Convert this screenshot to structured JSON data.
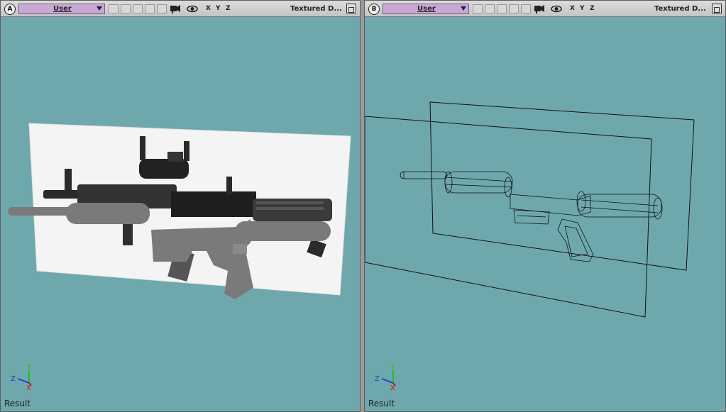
{
  "viewports": [
    {
      "letter": "A",
      "camera": "User",
      "axes": [
        "X",
        "Y",
        "Z"
      ],
      "shading": "Textured D...",
      "status": "Result",
      "gizmo": {
        "z": "Z",
        "y": "Y",
        "x": "X"
      }
    },
    {
      "letter": "B",
      "camera": "User",
      "axes": [
        "X",
        "Y",
        "Z"
      ],
      "shading": "Textured D...",
      "status": "Result",
      "gizmo": {
        "z": "Z",
        "y": "Y",
        "x": "X"
      }
    }
  ],
  "colors": {
    "viewport_bg": "#6ea8ad",
    "header_bg": "#cfcfcf",
    "camera_select": "#c8a8d4",
    "axis_x": "#d01010",
    "axis_y": "#20c020",
    "axis_z": "#2040d0"
  },
  "icons": [
    "camera-icon",
    "eye-icon",
    "maximize-icon"
  ]
}
